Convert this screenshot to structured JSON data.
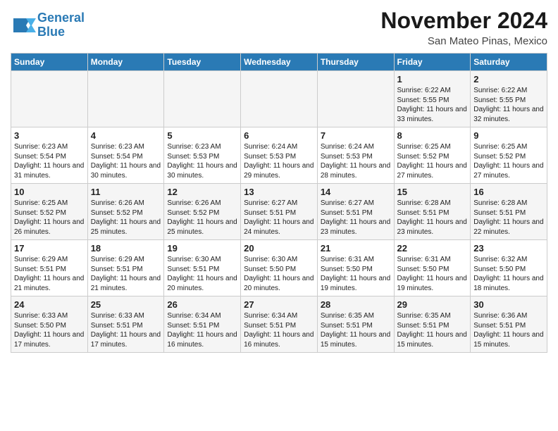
{
  "header": {
    "logo_line1": "General",
    "logo_line2": "Blue",
    "month": "November 2024",
    "location": "San Mateo Pinas, Mexico"
  },
  "weekdays": [
    "Sunday",
    "Monday",
    "Tuesday",
    "Wednesday",
    "Thursday",
    "Friday",
    "Saturday"
  ],
  "weeks": [
    [
      {
        "day": "",
        "sunrise": "",
        "sunset": "",
        "daylight": ""
      },
      {
        "day": "",
        "sunrise": "",
        "sunset": "",
        "daylight": ""
      },
      {
        "day": "",
        "sunrise": "",
        "sunset": "",
        "daylight": ""
      },
      {
        "day": "",
        "sunrise": "",
        "sunset": "",
        "daylight": ""
      },
      {
        "day": "",
        "sunrise": "",
        "sunset": "",
        "daylight": ""
      },
      {
        "day": "1",
        "sunrise": "Sunrise: 6:22 AM",
        "sunset": "Sunset: 5:55 PM",
        "daylight": "Daylight: 11 hours and 33 minutes."
      },
      {
        "day": "2",
        "sunrise": "Sunrise: 6:22 AM",
        "sunset": "Sunset: 5:55 PM",
        "daylight": "Daylight: 11 hours and 32 minutes."
      }
    ],
    [
      {
        "day": "3",
        "sunrise": "Sunrise: 6:23 AM",
        "sunset": "Sunset: 5:54 PM",
        "daylight": "Daylight: 11 hours and 31 minutes."
      },
      {
        "day": "4",
        "sunrise": "Sunrise: 6:23 AM",
        "sunset": "Sunset: 5:54 PM",
        "daylight": "Daylight: 11 hours and 30 minutes."
      },
      {
        "day": "5",
        "sunrise": "Sunrise: 6:23 AM",
        "sunset": "Sunset: 5:53 PM",
        "daylight": "Daylight: 11 hours and 30 minutes."
      },
      {
        "day": "6",
        "sunrise": "Sunrise: 6:24 AM",
        "sunset": "Sunset: 5:53 PM",
        "daylight": "Daylight: 11 hours and 29 minutes."
      },
      {
        "day": "7",
        "sunrise": "Sunrise: 6:24 AM",
        "sunset": "Sunset: 5:53 PM",
        "daylight": "Daylight: 11 hours and 28 minutes."
      },
      {
        "day": "8",
        "sunrise": "Sunrise: 6:25 AM",
        "sunset": "Sunset: 5:52 PM",
        "daylight": "Daylight: 11 hours and 27 minutes."
      },
      {
        "day": "9",
        "sunrise": "Sunrise: 6:25 AM",
        "sunset": "Sunset: 5:52 PM",
        "daylight": "Daylight: 11 hours and 27 minutes."
      }
    ],
    [
      {
        "day": "10",
        "sunrise": "Sunrise: 6:25 AM",
        "sunset": "Sunset: 5:52 PM",
        "daylight": "Daylight: 11 hours and 26 minutes."
      },
      {
        "day": "11",
        "sunrise": "Sunrise: 6:26 AM",
        "sunset": "Sunset: 5:52 PM",
        "daylight": "Daylight: 11 hours and 25 minutes."
      },
      {
        "day": "12",
        "sunrise": "Sunrise: 6:26 AM",
        "sunset": "Sunset: 5:52 PM",
        "daylight": "Daylight: 11 hours and 25 minutes."
      },
      {
        "day": "13",
        "sunrise": "Sunrise: 6:27 AM",
        "sunset": "Sunset: 5:51 PM",
        "daylight": "Daylight: 11 hours and 24 minutes."
      },
      {
        "day": "14",
        "sunrise": "Sunrise: 6:27 AM",
        "sunset": "Sunset: 5:51 PM",
        "daylight": "Daylight: 11 hours and 23 minutes."
      },
      {
        "day": "15",
        "sunrise": "Sunrise: 6:28 AM",
        "sunset": "Sunset: 5:51 PM",
        "daylight": "Daylight: 11 hours and 23 minutes."
      },
      {
        "day": "16",
        "sunrise": "Sunrise: 6:28 AM",
        "sunset": "Sunset: 5:51 PM",
        "daylight": "Daylight: 11 hours and 22 minutes."
      }
    ],
    [
      {
        "day": "17",
        "sunrise": "Sunrise: 6:29 AM",
        "sunset": "Sunset: 5:51 PM",
        "daylight": "Daylight: 11 hours and 21 minutes."
      },
      {
        "day": "18",
        "sunrise": "Sunrise: 6:29 AM",
        "sunset": "Sunset: 5:51 PM",
        "daylight": "Daylight: 11 hours and 21 minutes."
      },
      {
        "day": "19",
        "sunrise": "Sunrise: 6:30 AM",
        "sunset": "Sunset: 5:51 PM",
        "daylight": "Daylight: 11 hours and 20 minutes."
      },
      {
        "day": "20",
        "sunrise": "Sunrise: 6:30 AM",
        "sunset": "Sunset: 5:50 PM",
        "daylight": "Daylight: 11 hours and 20 minutes."
      },
      {
        "day": "21",
        "sunrise": "Sunrise: 6:31 AM",
        "sunset": "Sunset: 5:50 PM",
        "daylight": "Daylight: 11 hours and 19 minutes."
      },
      {
        "day": "22",
        "sunrise": "Sunrise: 6:31 AM",
        "sunset": "Sunset: 5:50 PM",
        "daylight": "Daylight: 11 hours and 19 minutes."
      },
      {
        "day": "23",
        "sunrise": "Sunrise: 6:32 AM",
        "sunset": "Sunset: 5:50 PM",
        "daylight": "Daylight: 11 hours and 18 minutes."
      }
    ],
    [
      {
        "day": "24",
        "sunrise": "Sunrise: 6:33 AM",
        "sunset": "Sunset: 5:50 PM",
        "daylight": "Daylight: 11 hours and 17 minutes."
      },
      {
        "day": "25",
        "sunrise": "Sunrise: 6:33 AM",
        "sunset": "Sunset: 5:51 PM",
        "daylight": "Daylight: 11 hours and 17 minutes."
      },
      {
        "day": "26",
        "sunrise": "Sunrise: 6:34 AM",
        "sunset": "Sunset: 5:51 PM",
        "daylight": "Daylight: 11 hours and 16 minutes."
      },
      {
        "day": "27",
        "sunrise": "Sunrise: 6:34 AM",
        "sunset": "Sunset: 5:51 PM",
        "daylight": "Daylight: 11 hours and 16 minutes."
      },
      {
        "day": "28",
        "sunrise": "Sunrise: 6:35 AM",
        "sunset": "Sunset: 5:51 PM",
        "daylight": "Daylight: 11 hours and 15 minutes."
      },
      {
        "day": "29",
        "sunrise": "Sunrise: 6:35 AM",
        "sunset": "Sunset: 5:51 PM",
        "daylight": "Daylight: 11 hours and 15 minutes."
      },
      {
        "day": "30",
        "sunrise": "Sunrise: 6:36 AM",
        "sunset": "Sunset: 5:51 PM",
        "daylight": "Daylight: 11 hours and 15 minutes."
      }
    ]
  ]
}
